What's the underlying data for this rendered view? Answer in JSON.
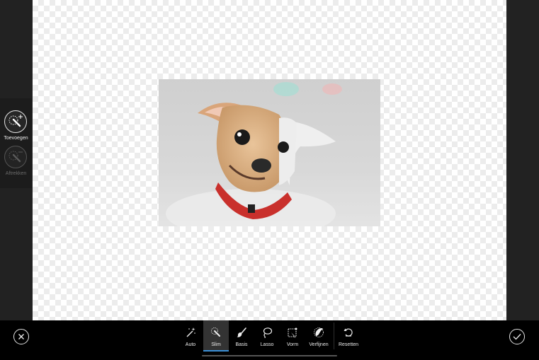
{
  "left_panel": {
    "add_label": "Toevoegen",
    "subtract_label": "Aftrekken"
  },
  "toolbar": {
    "tools": [
      {
        "label": "Auto",
        "icon": "magic-wand-icon"
      },
      {
        "label": "Slim",
        "icon": "smart-brush-icon",
        "active": true
      },
      {
        "label": "Basis",
        "icon": "brush-icon"
      },
      {
        "label": "Lasso",
        "icon": "lasso-icon"
      },
      {
        "label": "Vorm",
        "icon": "shape-icon"
      },
      {
        "label": "Verfijnen",
        "icon": "refine-icon"
      }
    ],
    "reset_label": "Resetten"
  },
  "colors": {
    "accent": "#3a8fd6",
    "bar": "#000000",
    "panel": "#1c1c1c"
  }
}
